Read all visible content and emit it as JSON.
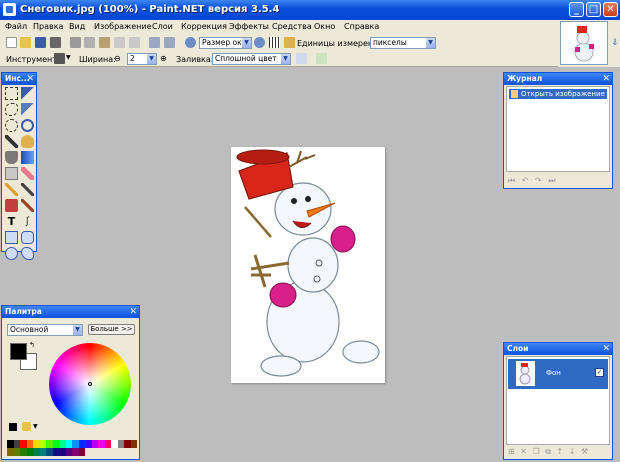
{
  "window": {
    "title": "Снеговик.jpg (100%) - Paint.NET версия 3.5.4",
    "min_label": "_",
    "max_label": "□",
    "close_label": "✕"
  },
  "menu": [
    "Файл",
    "Правка",
    "Вид",
    "Изображение",
    "Слои",
    "Коррекция",
    "Эффекты",
    "Средства",
    "Окно",
    "Справка"
  ],
  "toolbar": {
    "zoom_value": "Размер окн",
    "units_label": "Единицы измерения:",
    "units_value": "пикселы",
    "tool_label": "Инструмент:",
    "width_label": "Ширина:",
    "width_value": "2",
    "fill_label": "Заливка:",
    "fill_value": "Сплошной цвет"
  },
  "tools_panel": {
    "title": "Инс..."
  },
  "history_panel": {
    "title": "Журнал",
    "items": [
      "Открыть изображение"
    ]
  },
  "palette_panel": {
    "title": "Палитра",
    "mode_value": "Основной",
    "more_label": "Больше >>",
    "swatches": [
      "#000000",
      "#404040",
      "#ff0000",
      "#ff6a00",
      "#ffd800",
      "#b6ff00",
      "#4cff00",
      "#00ff21",
      "#00ff90",
      "#00ffff",
      "#0094ff",
      "#0026ff",
      "#4800ff",
      "#b200ff",
      "#ff00dc",
      "#ff006e",
      "#ffffff",
      "#808080",
      "#7f0000",
      "#7f3300",
      "#7f6a00",
      "#5b7f00",
      "#267f00",
      "#007f0e",
      "#007f46",
      "#007f7f",
      "#004a7f",
      "#00137f",
      "#21007f",
      "#57007f",
      "#7f006e",
      "#7f0037"
    ]
  },
  "layers_panel": {
    "title": "Слои",
    "layer_name": "Фон"
  },
  "colors": {
    "primary": "#000000",
    "secondary": "#ffffff",
    "titlebar": "#0a52dd",
    "selection": "#316ac5"
  }
}
